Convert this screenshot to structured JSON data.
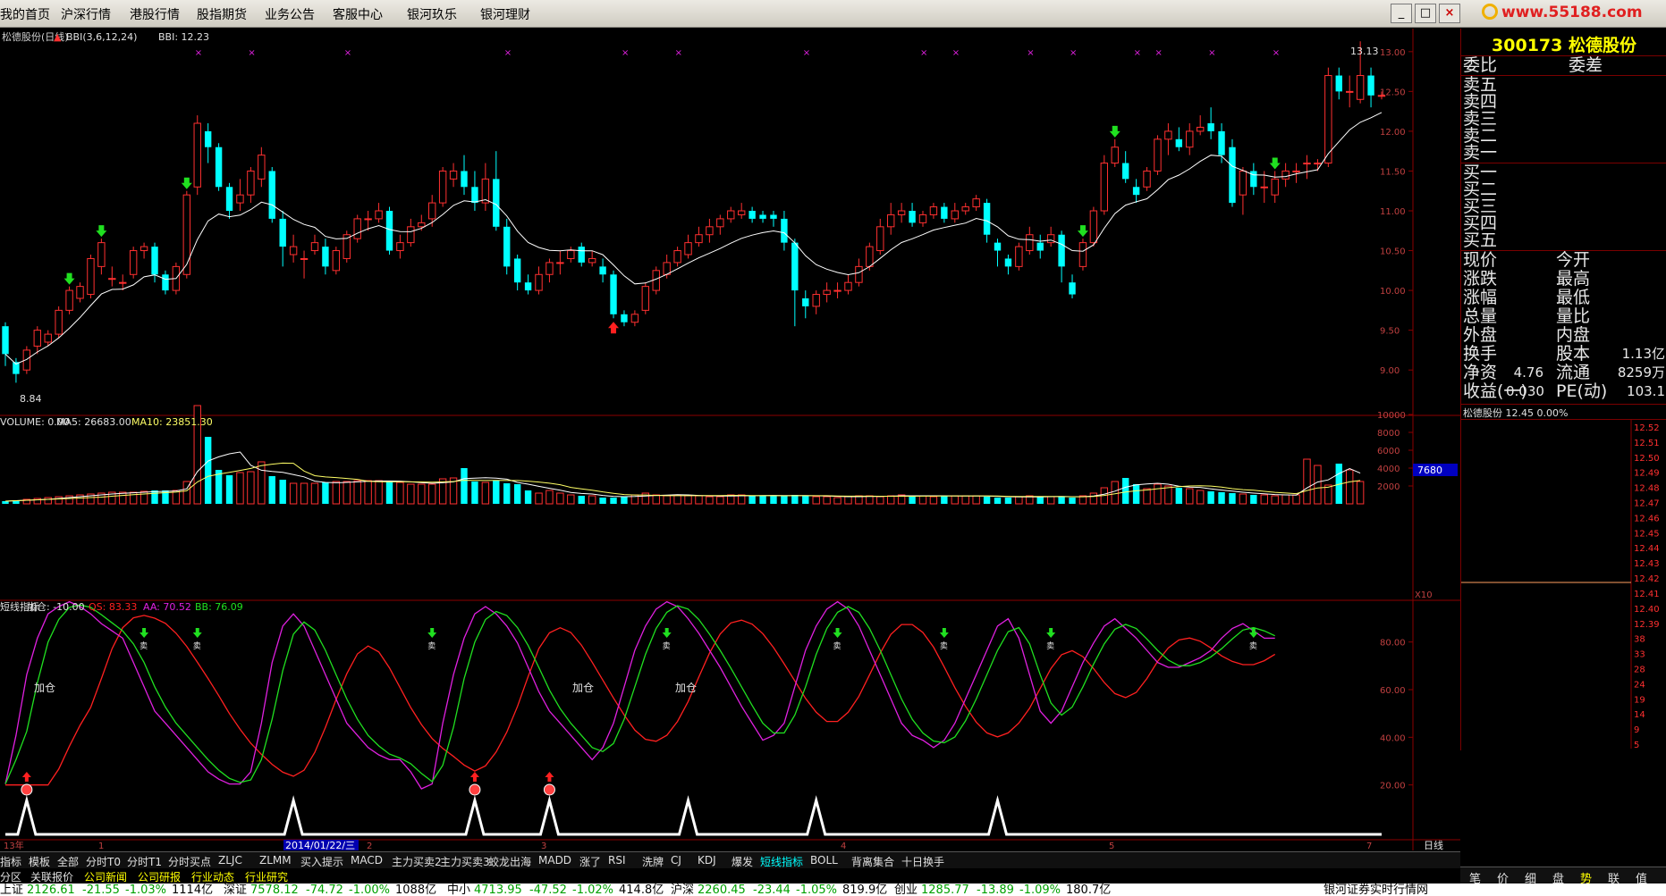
{
  "menu": [
    "我的首页",
    "沪深行情",
    "港股行情",
    "股指期货",
    "业务公告",
    "客服中心",
    "银河玖乐",
    "银河理财"
  ],
  "window_buttons": [
    "_",
    "□",
    "×"
  ],
  "logo_text": "www.55188.com",
  "kline": {
    "title": "松德股份(日线)",
    "bbi_label": "BBI(3,6,12,24)",
    "bbi_value": "BBI: 12.23",
    "high_mark": "13.13",
    "low_mark": "8.84",
    "y_ticks": [
      "13.00",
      "12.50",
      "12.00",
      "11.50",
      "11.00",
      "10.50",
      "10.00",
      "9.50",
      "9.00"
    ]
  },
  "volume": {
    "label_vol": "VOLUME: 0.00",
    "label_ma5": "MA5: 26683.00",
    "label_ma10": "MA10: 23851.30",
    "y_ticks": [
      "10000",
      "8000",
      "6000",
      "4000",
      "2000"
    ],
    "cursor_value": "7680",
    "unit": "X10"
  },
  "indicator": {
    "name": "短线指标",
    "jiacang_value": "加仓: -10.00",
    "qs": "QS: 83.33",
    "aa": "AA: 70.52",
    "bb": "BB: 76.09",
    "y_ticks": [
      "80.00",
      "60.00",
      "40.00",
      "20.00"
    ],
    "jiacang_text": "加仓",
    "sell_text": "卖"
  },
  "xaxis": {
    "labels": [
      "13年",
      "1",
      "2",
      "3",
      "4",
      "5",
      "7"
    ],
    "cursor_date": "2014/01/22/三",
    "period": "日线"
  },
  "info": {
    "code_name": "300173 松德股份",
    "weibi": "委比",
    "weicha": "委差",
    "sell": [
      "卖五",
      "卖四",
      "卖三",
      "卖二",
      "卖一"
    ],
    "buy": [
      "买一",
      "买二",
      "买三",
      "买四",
      "买五"
    ],
    "rows": [
      [
        "现价",
        "",
        "今开",
        ""
      ],
      [
        "涨跌",
        "",
        "最高",
        ""
      ],
      [
        "涨幅",
        "",
        "最低",
        ""
      ],
      [
        "总量",
        "",
        "量比",
        ""
      ],
      [
        "外盘",
        "",
        "内盘",
        ""
      ],
      [
        "换手",
        "",
        "股本",
        "1.13亿"
      ],
      [
        "净资",
        "4.76",
        "流通",
        "8259万"
      ],
      [
        "收益(一)",
        "0.030",
        "PE(动)",
        "103.1"
      ]
    ],
    "mini_title": "松德股份 12.45 0.00%",
    "mini_ticks": [
      "12.52",
      "12.51",
      "12.50",
      "12.49",
      "12.48",
      "12.47",
      "12.46",
      "12.45",
      "12.44",
      "12.43",
      "12.42",
      "12.41",
      "12.40",
      "12.39",
      "38",
      "33",
      "28",
      "24",
      "19",
      "14",
      "9",
      "5"
    ],
    "tabs": [
      "笔",
      "价",
      "细",
      "盘",
      "势",
      "联",
      "值"
    ]
  },
  "tabs1": [
    "指标",
    "模板",
    "全部",
    "分时T0",
    "分时T1",
    "分时买点",
    "ZLJC",
    "ZLMM",
    "买入提示",
    "MACD",
    "主力买卖2",
    "主力买卖3",
    "蛟龙出海",
    "MADD",
    "涨了",
    "RSI",
    "洗牌",
    "CJ",
    "KDJ",
    "爆发",
    "短线指标",
    "BOLL",
    "背离集合",
    "十日换手"
  ],
  "tabs2": [
    "分区",
    "关联报价",
    "公司新闻",
    "公司研报",
    "行业动态",
    "行业研究"
  ],
  "ticker": [
    {
      "name": "上证",
      "price": "2126.61",
      "chg": "-21.55",
      "pct": "-1.03%",
      "amt": "1114亿"
    },
    {
      "name": "深证",
      "price": "7578.12",
      "chg": "-74.72",
      "pct": "-1.00%",
      "amt": "1088亿"
    },
    {
      "name": "中小",
      "price": "4713.95",
      "chg": "-47.52",
      "pct": "-1.02%",
      "amt": "414.8亿"
    },
    {
      "name": "沪深",
      "price": "2260.45",
      "chg": "-23.44",
      "pct": "-1.05%",
      "amt": "819.9亿"
    },
    {
      "name": "创业",
      "price": "1285.77",
      "chg": "-13.89",
      "pct": "-1.09%",
      "amt": "180.7亿"
    }
  ],
  "ticker_right": "银河证券实时行情网",
  "colors": {
    "up": "#ff3030",
    "down": "#00ffff",
    "bg": "#000000",
    "frame": "#8b0000",
    "ma": "#ffffff",
    "qs": "#ff2020",
    "aa": "#e020e0",
    "bb": "#20e020"
  },
  "chart_data": {
    "type": "candlestick",
    "ylim": [
      8.8,
      13.2
    ],
    "candles": [
      [
        9.55,
        9.2,
        9.6,
        9.05
      ],
      [
        9.1,
        8.95,
        9.15,
        8.84
      ],
      [
        9.0,
        9.25,
        9.3,
        8.95
      ],
      [
        9.3,
        9.5,
        9.55,
        9.2
      ],
      [
        9.35,
        9.45,
        9.5,
        9.3
      ],
      [
        9.45,
        9.75,
        9.8,
        9.4
      ],
      [
        9.75,
        10.0,
        10.05,
        9.7
      ],
      [
        9.9,
        10.05,
        10.1,
        9.85
      ],
      [
        9.95,
        10.4,
        10.45,
        9.9
      ],
      [
        10.3,
        10.6,
        10.65,
        10.2
      ],
      [
        10.15,
        10.15,
        10.3,
        10.05
      ],
      [
        10.1,
        10.1,
        10.2,
        10.0
      ],
      [
        10.2,
        10.5,
        10.55,
        10.15
      ],
      [
        10.5,
        10.55,
        10.6,
        10.4
      ],
      [
        10.55,
        10.2,
        10.6,
        10.1
      ],
      [
        10.2,
        10.0,
        10.25,
        9.95
      ],
      [
        10.0,
        10.3,
        10.35,
        9.95
      ],
      [
        10.2,
        11.2,
        11.25,
        10.15
      ],
      [
        11.3,
        12.1,
        12.2,
        11.2
      ],
      [
        12.0,
        11.8,
        12.1,
        11.6
      ],
      [
        11.8,
        11.3,
        11.85,
        11.25
      ],
      [
        11.3,
        11.0,
        11.35,
        10.9
      ],
      [
        11.1,
        11.2,
        11.4,
        11.0
      ],
      [
        11.2,
        11.5,
        11.55,
        11.1
      ],
      [
        11.4,
        11.7,
        11.8,
        11.3
      ],
      [
        11.5,
        10.9,
        11.55,
        10.85
      ],
      [
        10.9,
        10.55,
        11.0,
        10.3
      ],
      [
        10.45,
        10.55,
        10.7,
        10.35
      ],
      [
        10.4,
        10.4,
        10.5,
        10.15
      ],
      [
        10.5,
        10.6,
        10.7,
        10.45
      ],
      [
        10.55,
        10.3,
        10.65,
        10.2
      ],
      [
        10.25,
        10.5,
        10.55,
        10.2
      ],
      [
        10.4,
        10.7,
        10.75,
        10.35
      ],
      [
        10.65,
        10.9,
        10.95,
        10.6
      ],
      [
        10.9,
        10.9,
        11.0,
        10.75
      ],
      [
        10.9,
        11.0,
        11.1,
        10.85
      ],
      [
        11.0,
        10.5,
        11.05,
        10.45
      ],
      [
        10.5,
        10.6,
        10.7,
        10.4
      ],
      [
        10.6,
        10.8,
        10.9,
        10.55
      ],
      [
        10.8,
        10.85,
        10.95,
        10.75
      ],
      [
        10.9,
        11.1,
        11.2,
        10.8
      ],
      [
        11.1,
        11.5,
        11.55,
        11.05
      ],
      [
        11.4,
        11.5,
        11.6,
        11.3
      ],
      [
        11.5,
        11.3,
        11.7,
        11.2
      ],
      [
        11.3,
        11.1,
        11.5,
        11.0
      ],
      [
        11.1,
        11.4,
        11.6,
        11.0
      ],
      [
        11.4,
        10.8,
        11.75,
        10.75
      ],
      [
        10.8,
        10.3,
        10.9,
        10.2
      ],
      [
        10.4,
        10.1,
        10.45,
        10.0
      ],
      [
        10.1,
        10.0,
        10.2,
        9.95
      ],
      [
        10.0,
        10.2,
        10.3,
        9.95
      ],
      [
        10.2,
        10.35,
        10.4,
        10.1
      ],
      [
        10.35,
        10.35,
        10.5,
        10.2
      ],
      [
        10.4,
        10.5,
        10.55,
        10.35
      ],
      [
        10.55,
        10.35,
        10.6,
        10.3
      ],
      [
        10.35,
        10.4,
        10.5,
        10.3
      ],
      [
        10.3,
        10.2,
        10.4,
        10.1
      ],
      [
        10.2,
        9.7,
        10.25,
        9.65
      ],
      [
        9.7,
        9.6,
        9.75,
        9.55
      ],
      [
        9.6,
        9.7,
        9.75,
        9.55
      ],
      [
        9.75,
        10.05,
        10.1,
        9.7
      ],
      [
        10.0,
        10.25,
        10.3,
        9.95
      ],
      [
        10.2,
        10.35,
        10.45,
        10.15
      ],
      [
        10.35,
        10.5,
        10.55,
        10.3
      ],
      [
        10.45,
        10.6,
        10.7,
        10.4
      ],
      [
        10.6,
        10.7,
        10.8,
        10.55
      ],
      [
        10.7,
        10.8,
        10.9,
        10.6
      ],
      [
        10.8,
        10.9,
        10.95,
        10.7
      ],
      [
        10.9,
        11.0,
        11.05,
        10.85
      ],
      [
        10.95,
        11.0,
        11.1,
        10.9
      ],
      [
        11.0,
        10.9,
        11.05,
        10.85
      ],
      [
        10.95,
        10.9,
        11.0,
        10.85
      ],
      [
        10.95,
        10.9,
        11.0,
        10.8
      ],
      [
        10.9,
        10.6,
        11.0,
        10.5
      ],
      [
        10.6,
        10.0,
        10.65,
        9.55
      ],
      [
        9.9,
        9.8,
        10.0,
        9.65
      ],
      [
        9.8,
        9.95,
        10.0,
        9.7
      ],
      [
        9.95,
        10.0,
        10.1,
        9.85
      ],
      [
        10.0,
        10.0,
        10.1,
        9.9
      ],
      [
        10.0,
        10.1,
        10.2,
        9.95
      ],
      [
        10.1,
        10.3,
        10.4,
        10.05
      ],
      [
        10.3,
        10.55,
        10.6,
        10.25
      ],
      [
        10.5,
        10.8,
        10.9,
        10.45
      ],
      [
        10.8,
        10.95,
        11.1,
        10.7
      ],
      [
        10.95,
        11.0,
        11.1,
        10.85
      ],
      [
        11.0,
        10.85,
        11.1,
        10.8
      ],
      [
        10.85,
        10.95,
        11.0,
        10.8
      ],
      [
        10.95,
        11.05,
        11.1,
        10.9
      ],
      [
        11.05,
        10.9,
        11.1,
        10.85
      ],
      [
        10.9,
        11.0,
        11.1,
        10.85
      ],
      [
        11.0,
        11.05,
        11.1,
        10.95
      ],
      [
        11.05,
        11.15,
        11.2,
        11.0
      ],
      [
        11.1,
        10.7,
        11.15,
        10.6
      ],
      [
        10.6,
        10.5,
        10.65,
        10.3
      ],
      [
        10.4,
        10.3,
        10.45,
        10.2
      ],
      [
        10.3,
        10.55,
        10.6,
        10.25
      ],
      [
        10.5,
        10.7,
        10.8,
        10.45
      ],
      [
        10.6,
        10.5,
        10.7,
        10.4
      ],
      [
        10.6,
        10.7,
        10.8,
        10.55
      ],
      [
        10.7,
        10.3,
        10.75,
        10.1
      ],
      [
        10.1,
        9.95,
        10.2,
        9.9
      ],
      [
        10.3,
        10.6,
        10.65,
        10.25
      ],
      [
        10.6,
        11.0,
        11.05,
        10.55
      ],
      [
        11.0,
        11.6,
        11.7,
        10.95
      ],
      [
        11.6,
        11.8,
        11.9,
        11.55
      ],
      [
        11.6,
        11.4,
        11.75,
        11.35
      ],
      [
        11.3,
        11.2,
        11.4,
        11.1
      ],
      [
        11.3,
        11.5,
        11.55,
        11.25
      ],
      [
        11.5,
        11.9,
        11.95,
        11.45
      ],
      [
        11.9,
        12.0,
        12.1,
        11.7
      ],
      [
        11.9,
        11.8,
        12.05,
        11.75
      ],
      [
        11.8,
        12.0,
        12.1,
        11.7
      ],
      [
        12.0,
        12.05,
        12.2,
        11.95
      ],
      [
        12.1,
        12.0,
        12.3,
        11.9
      ],
      [
        12.0,
        11.7,
        12.1,
        11.6
      ],
      [
        11.8,
        11.1,
        11.9,
        11.05
      ],
      [
        11.2,
        11.5,
        11.55,
        10.95
      ],
      [
        11.5,
        11.3,
        11.6,
        11.2
      ],
      [
        11.3,
        11.3,
        11.5,
        11.1
      ],
      [
        11.2,
        11.4,
        11.5,
        11.1
      ],
      [
        11.4,
        11.5,
        11.6,
        11.3
      ],
      [
        11.5,
        11.5,
        11.6,
        11.35
      ],
      [
        11.6,
        11.6,
        11.7,
        11.4
      ],
      [
        11.6,
        11.6,
        11.65,
        11.5
      ],
      [
        11.6,
        12.7,
        12.8,
        11.55
      ],
      [
        12.7,
        12.5,
        12.8,
        12.4
      ],
      [
        12.5,
        12.5,
        12.7,
        12.3
      ],
      [
        12.4,
        12.7,
        13.13,
        12.35
      ],
      [
        12.7,
        12.45,
        12.8,
        12.3
      ],
      [
        12.45,
        12.45,
        12.5,
        12.4
      ]
    ],
    "volumes": [
      300,
      400,
      500,
      600,
      700,
      800,
      900,
      1000,
      1100,
      1200,
      1300,
      1300,
      1300,
      1400,
      1500,
      1500,
      1500,
      2500,
      11000,
      7500,
      3800,
      3200,
      3500,
      3600,
      4700,
      3100,
      2700,
      2300,
      2300,
      2300,
      2400,
      2500,
      2500,
      2600,
      2600,
      2600,
      2500,
      2400,
      2200,
      2200,
      2200,
      2800,
      2900,
      4000,
      2500,
      2400,
      2600,
      2300,
      2200,
      1500,
      1200,
      1500,
      1200,
      1000,
      900,
      900,
      700,
      700,
      800,
      1000,
      1200,
      1000,
      900,
      1000,
      900,
      900,
      800,
      800,
      1000,
      1000,
      900,
      900,
      900,
      900,
      1000,
      900,
      800,
      800,
      700,
      800,
      900,
      900,
      800,
      900,
      1000,
      900,
      900,
      800,
      900,
      900,
      900,
      900,
      800,
      700,
      700,
      800,
      900,
      800,
      800,
      800,
      700,
      900,
      1200,
      1800,
      2500,
      2900,
      2200,
      1700,
      2200,
      2000,
      1800,
      1700,
      1500,
      1400,
      1300,
      1200,
      1100,
      1000,
      1000,
      900,
      1000,
      1000,
      5000,
      4300,
      2100,
      4500,
      3800,
      2500
    ],
    "ma_bbi": "computed",
    "qs": [
      20,
      20,
      40,
      65,
      80,
      90,
      93,
      95,
      93,
      90,
      86,
      83,
      80,
      70,
      60,
      50,
      45,
      40,
      35,
      30,
      25,
      22,
      20,
      20,
      25,
      45,
      70,
      85,
      90,
      85,
      75,
      65,
      55,
      45,
      40,
      35,
      32,
      30,
      30,
      25,
      18,
      20,
      45,
      65,
      80,
      90,
      93,
      90,
      85,
      78,
      68,
      58,
      50,
      45,
      40,
      35,
      30,
      35,
      45,
      60,
      75,
      85,
      92,
      95,
      93,
      88,
      82,
      75,
      68,
      60,
      52,
      45,
      38,
      40,
      45,
      60,
      75,
      85,
      92,
      95,
      92,
      85,
      75,
      65,
      55,
      45,
      40,
      38,
      35,
      38,
      45,
      55,
      65,
      75,
      85,
      88,
      80,
      65,
      50,
      45,
      50,
      60,
      70,
      78,
      85,
      88,
      84,
      80,
      75,
      70,
      68,
      68,
      70,
      72,
      75,
      80,
      84,
      86,
      83,
      80
    ]
  }
}
